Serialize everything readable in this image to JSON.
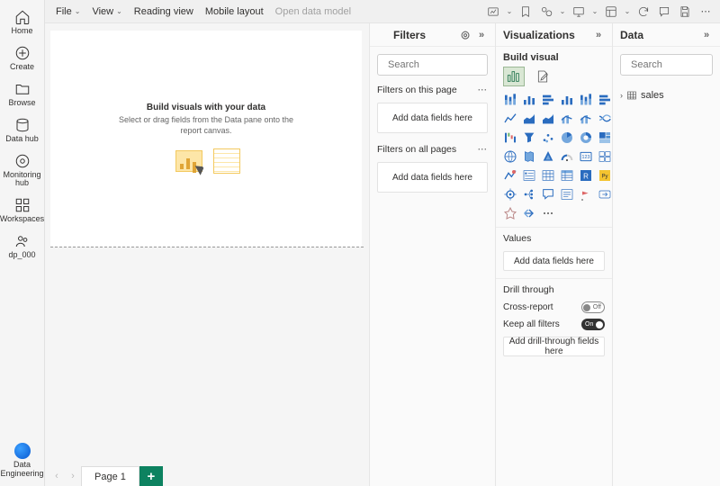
{
  "nav": {
    "home": "Home",
    "create": "Create",
    "browse": "Browse",
    "datahub": "Data hub",
    "monitoring": "Monitoring hub",
    "workspaces": "Workspaces",
    "user": "dp_000",
    "footer": "Data Engineering"
  },
  "menu": {
    "file": "File",
    "view": "View",
    "reading": "Reading view",
    "mobile": "Mobile layout",
    "openmodel": "Open data model"
  },
  "filters": {
    "title": "Filters",
    "search_ph": "Search",
    "on_page": "Filters on this page",
    "on_all": "Filters on all pages",
    "drop": "Add data fields here"
  },
  "viz": {
    "title": "Visualizations",
    "build": "Build visual",
    "values": "Values",
    "drop": "Add data fields here",
    "drill": "Drill through",
    "cross": "Cross-report",
    "keep": "Keep all filters",
    "drilldrop": "Add drill-through fields here"
  },
  "data": {
    "title": "Data",
    "search_ph": "Search",
    "table": "sales"
  },
  "canvas": {
    "title": "Build visuals with your data",
    "sub1": "Select or drag fields from the Data pane onto the",
    "sub2": "report canvas."
  },
  "tabs": {
    "page1": "Page 1"
  }
}
